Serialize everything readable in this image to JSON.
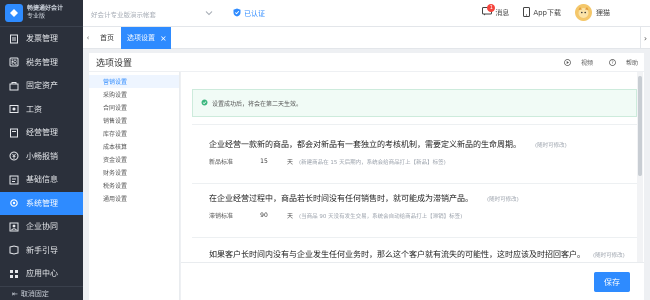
{
  "app": {
    "logo_line1": "畅捷通好会计",
    "logo_line2": "专业版"
  },
  "sidebar": {
    "items": [
      {
        "label": "发票管理",
        "icon": "invoice-icon",
        "active": false
      },
      {
        "label": "税务管理",
        "icon": "tax-icon",
        "active": false
      },
      {
        "label": "固定资产",
        "icon": "asset-icon",
        "active": false
      },
      {
        "label": "工资",
        "icon": "salary-icon",
        "active": false
      },
      {
        "label": "经营管理",
        "icon": "business-icon",
        "active": false
      },
      {
        "label": "小畅报销",
        "icon": "reimburse-icon",
        "active": false
      },
      {
        "label": "基础信息",
        "icon": "info-icon",
        "active": false
      },
      {
        "label": "系统管理",
        "icon": "settings-icon",
        "active": true
      },
      {
        "label": "企业协同",
        "icon": "collab-icon",
        "active": false
      },
      {
        "label": "新手引导",
        "icon": "guide-icon",
        "active": false
      },
      {
        "label": "应用中心",
        "icon": "apps-icon",
        "active": false
      }
    ],
    "footer": "取消固定"
  },
  "topbar": {
    "search_placeholder": "好会计专业版演示帐套",
    "cert_label": "已认证",
    "messages_label": "消息",
    "messages_count": "1",
    "download_label": "App下载",
    "user_name": "狸猫"
  },
  "tabs": {
    "home": "首页",
    "active": "选项设置"
  },
  "page": {
    "title": "选项设置",
    "video_label": "视频",
    "help_label": "帮助"
  },
  "settings_menu": [
    {
      "label": "营销设置",
      "active": true
    },
    {
      "label": "采购设置",
      "active": false
    },
    {
      "label": "合同设置",
      "active": false
    },
    {
      "label": "销售设置",
      "active": false
    },
    {
      "label": "库存设置",
      "active": false
    },
    {
      "label": "成本核算",
      "active": false
    },
    {
      "label": "资金设置",
      "active": false
    },
    {
      "label": "财务设置",
      "active": false
    },
    {
      "label": "税务设置",
      "active": false
    },
    {
      "label": "通用设置",
      "active": false
    }
  ],
  "notice": "设置成功后，将会在第二天生效。",
  "sections": [
    {
      "title": "企业经营一款新的商品，都会对新品有一套独立的考核机制，需要定义新品的生命周期。",
      "tag": "(随时可修改)",
      "field_label": "新品标准",
      "value": "15",
      "unit": "天",
      "hint": "(新建商品在 15 天后期内，系统会给商品打上【新品】标签)"
    },
    {
      "title": "在企业经营过程中，商品若长时间没有任何销售时，就可能成为滞销产品。",
      "tag": "(随时可修改)",
      "field_label": "滞销标准",
      "value": "90",
      "unit": "天",
      "hint": "(当商品 90 天没有发生交易，系统会自动给商品打上【滞销】标签)"
    },
    {
      "title": "如果客户长时间内没有与企业发生任何业务时，那么这个客户就有流失的可能性，这时应该及时招回客户。",
      "tag": "(随时可修改)"
    }
  ],
  "save_label": "保存",
  "colors": {
    "accent": "#2e8bff",
    "sidebar_bg": "#2b303b",
    "notice_bg": "#f1fbf6"
  }
}
